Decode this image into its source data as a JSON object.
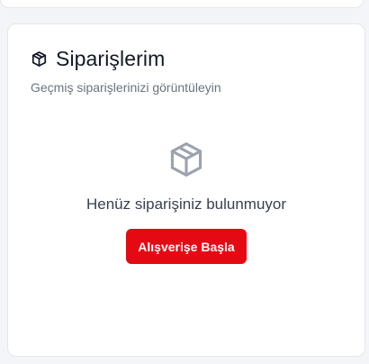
{
  "orders": {
    "title": "Siparişlerim",
    "subtitle": "Geçmiş siparişlerinizi görüntüleyin",
    "title_icon": "package-icon",
    "empty_state": {
      "icon": "package-icon",
      "message": "Henüz siparişiniz bulunmuyor",
      "button_label": "Alışverişe Başla"
    }
  },
  "colors": {
    "accent": "#e50914",
    "muted_icon": "#9ca3af",
    "title": "#111827",
    "subtitle": "#6b7280"
  }
}
